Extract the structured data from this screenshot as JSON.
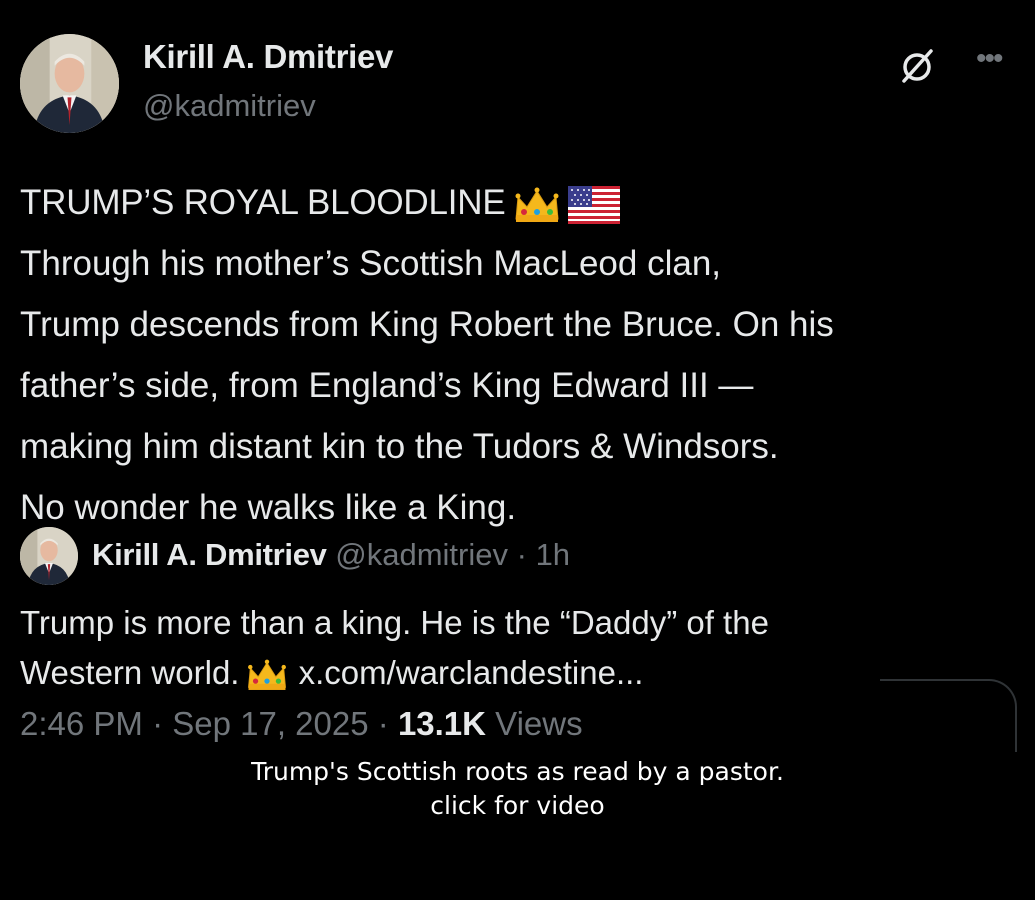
{
  "tweet": {
    "author": {
      "display_name": "Kirill A. Dmitriev",
      "handle": "@kadmitriev"
    },
    "icons": {
      "grok": "grok-icon",
      "more": "more-options-icon",
      "crown": "crown-emoji",
      "flag": "us-flag-emoji"
    },
    "body": {
      "headline": "TRUMP’S ROYAL BLOODLINE",
      "lines": [
        "Through his mother’s Scottish MacLeod clan,",
        "Trump descends from King Robert the Bruce. On his",
        "father’s side, from England’s King Edward III —",
        "making him distant kin to the Tudors & Windsors.",
        "No wonder he walks like a King."
      ]
    },
    "quoted": {
      "display_name": "Kirill A. Dmitriev",
      "handle": "@kadmitriev",
      "separator": "·",
      "time": "1h",
      "line1": "Trump is more than a king. He is the “Daddy” of the",
      "line2_prefix": "Western world.",
      "line2_link": "x.com/warclandestine..."
    },
    "meta": {
      "time": "2:46 PM",
      "sep1": "·",
      "date": "Sep 17, 2025",
      "sep2": "·",
      "views_count": "13.1K",
      "views_label": "Views"
    }
  },
  "caption": {
    "line1": "Trump's Scottish roots as read by a pastor.",
    "line2": "click for video"
  },
  "colors": {
    "background": "#000000",
    "text_primary": "#e7e9ea",
    "text_secondary": "#71767b"
  }
}
